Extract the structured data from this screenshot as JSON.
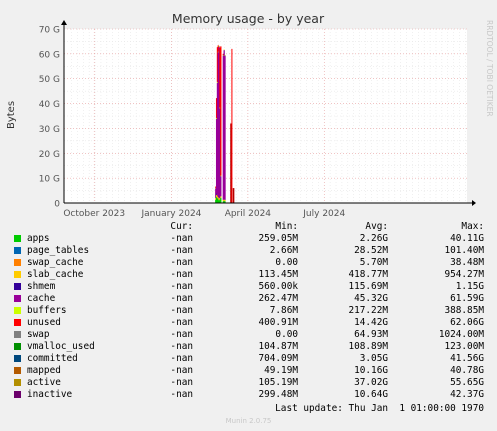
{
  "chart_data": {
    "type": "area",
    "title": "Memory usage - by year",
    "ylabel": "Bytes",
    "side_label": "RRDTOOL / TOBI OETIKER",
    "ylim": [
      0,
      70
    ],
    "y_unit": "G",
    "y_ticks": [
      "0",
      "10 G",
      "20 G",
      "30 G",
      "40 G",
      "50 G",
      "60 G",
      "70 G"
    ],
    "x_range": [
      "2023-08-26",
      "2024-12-18"
    ],
    "x_ticks": [
      {
        "date": "2023-10-01",
        "label": "October 2023"
      },
      {
        "date": "2024-01-01",
        "label": "January 2024"
      },
      {
        "date": "2024-04-01",
        "label": "April 2024"
      },
      {
        "date": "2024-07-01",
        "label": "July 2024"
      }
    ],
    "stack_order": [
      "apps",
      "page_tables",
      "swap_cache",
      "slab_cache",
      "shmem",
      "cache",
      "buffers",
      "unused"
    ],
    "stack_segments": [
      {
        "date": "2024-02-22",
        "values": [
          1.2,
          0.1,
          0.0,
          0.8,
          0.3,
          3.5,
          0.2,
          0.5
        ]
      },
      {
        "date": "2024-02-23",
        "values": [
          2.3,
          0.1,
          0.0,
          0.9,
          0.5,
          30.0,
          0.4,
          8.0
        ]
      },
      {
        "date": "2024-02-24",
        "values": [
          2.0,
          0.1,
          0.0,
          0.9,
          0.3,
          45.0,
          0.4,
          14.0
        ]
      },
      {
        "date": "2024-02-25",
        "values": [
          1.5,
          0.1,
          0.0,
          0.8,
          0.2,
          58.0,
          0.3,
          2.5
        ]
      },
      {
        "date": "2024-02-26",
        "values": [
          1.0,
          0.1,
          0.0,
          0.7,
          0.1,
          61.0,
          0.3,
          0.0
        ]
      },
      {
        "date": "2024-02-27",
        "values": [
          1.3,
          0.1,
          0.0,
          0.6,
          0.1,
          36.0,
          0.3,
          24.0
        ]
      },
      {
        "date": "2024-02-28",
        "values": [
          2.0,
          0.1,
          0.0,
          0.6,
          0.1,
          8.0,
          0.2,
          52.0
        ]
      },
      {
        "date": "2024-03-02",
        "values": [
          0.6,
          0.1,
          0.0,
          0.5,
          0.1,
          58.0,
          0.2,
          0.5
        ]
      },
      {
        "date": "2024-03-03",
        "values": [
          0.8,
          0.1,
          0.0,
          0.5,
          0.1,
          60.0,
          0.2,
          0.0
        ]
      },
      {
        "date": "2024-03-04",
        "values": [
          0.6,
          0.1,
          0.0,
          0.5,
          0.1,
          58.0,
          0.2,
          0.0
        ]
      }
    ],
    "swap_bars": [
      {
        "date": "2024-03-11",
        "value": 32
      },
      {
        "date": "2024-03-14",
        "value": 6
      }
    ],
    "unused_lines": [
      {
        "date": "2024-03-13",
        "value": 62
      }
    ],
    "legend": {
      "headers": {
        "cur": "Cur:",
        "min": "Min:",
        "avg": "Avg:",
        "max": "Max:"
      },
      "rows": [
        {
          "name": "apps",
          "color": "#00cc00",
          "cur": "-nan",
          "min": "259.05M",
          "avg": "2.26G",
          "max": "40.11G"
        },
        {
          "name": "page_tables",
          "color": "#0066b3",
          "cur": "-nan",
          "min": "2.66M",
          "avg": "28.52M",
          "max": "101.40M"
        },
        {
          "name": "swap_cache",
          "color": "#ff8000",
          "cur": "-nan",
          "min": "0.00",
          "avg": "5.70M",
          "max": "38.48M"
        },
        {
          "name": "slab_cache",
          "color": "#ffcc00",
          "cur": "-nan",
          "min": "113.45M",
          "avg": "418.77M",
          "max": "954.27M"
        },
        {
          "name": "shmem",
          "color": "#330099",
          "cur": "-nan",
          "min": "560.00k",
          "avg": "115.69M",
          "max": "1.15G"
        },
        {
          "name": "cache",
          "color": "#990099",
          "cur": "-nan",
          "min": "262.47M",
          "avg": "45.32G",
          "max": "61.59G"
        },
        {
          "name": "buffers",
          "color": "#ccff00",
          "cur": "-nan",
          "min": "7.86M",
          "avg": "217.22M",
          "max": "388.85M"
        },
        {
          "name": "unused",
          "color": "#ff0000",
          "cur": "-nan",
          "min": "400.91M",
          "avg": "14.42G",
          "max": "62.06G"
        },
        {
          "name": "swap",
          "color": "#808080",
          "cur": "-nan",
          "min": "0.00",
          "avg": "64.93M",
          "max": "1024.00M"
        },
        {
          "name": "vmalloc_used",
          "color": "#008f00",
          "cur": "-nan",
          "min": "104.87M",
          "avg": "108.89M",
          "max": "123.00M"
        },
        {
          "name": "committed",
          "color": "#00487d",
          "cur": "-nan",
          "min": "704.09M",
          "avg": "3.05G",
          "max": "41.56G"
        },
        {
          "name": "mapped",
          "color": "#b35a00",
          "cur": "-nan",
          "min": "49.19M",
          "avg": "10.16G",
          "max": "40.78G"
        },
        {
          "name": "active",
          "color": "#b38f00",
          "cur": "-nan",
          "min": "105.19M",
          "avg": "37.02G",
          "max": "55.65G"
        },
        {
          "name": "inactive",
          "color": "#6b006b",
          "cur": "-nan",
          "min": "299.48M",
          "avg": "10.64G",
          "max": "42.37G"
        }
      ]
    },
    "last_update": "Last update: Thu Jan  1 01:00:00 1970",
    "munin_version": "Munin 2.0.75"
  },
  "colors": {
    "background": "#f0f0f0",
    "plot_background": "#ffffff",
    "grid_major": "#e8a0a0",
    "grid_minor": "#e6e6e6",
    "axis": "#000000"
  }
}
